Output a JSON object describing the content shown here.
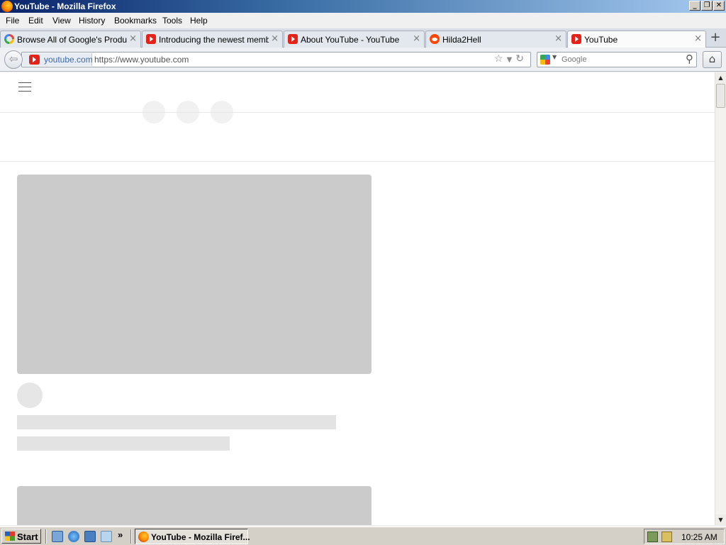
{
  "window": {
    "title": "YouTube - Mozilla Firefox",
    "controls": [
      "minimize",
      "maximize",
      "close"
    ]
  },
  "menu": {
    "items": [
      "File",
      "Edit",
      "View",
      "History",
      "Bookmarks",
      "Tools",
      "Help"
    ]
  },
  "tabs": [
    {
      "label": "Browse All of Google's Product...",
      "favicon": "google-icon",
      "active": false
    },
    {
      "label": "Introducing the newest memb...",
      "favicon": "youtube-icon",
      "active": false
    },
    {
      "label": "About YouTube - YouTube",
      "favicon": "youtube-icon",
      "active": false
    },
    {
      "label": "Hilda2Hell",
      "favicon": "reddit-icon",
      "active": false
    },
    {
      "label": "YouTube",
      "favicon": "youtube-icon",
      "active": true
    }
  ],
  "navbar": {
    "identity_label": "youtube.com",
    "url": "https://www.youtube.com",
    "search_placeholder": "Google"
  },
  "taskbar": {
    "start_label": "Start",
    "task_label": "YouTube - Mozilla Firef...",
    "clock": "10:25 AM",
    "overflow_glyph": "»"
  },
  "colors": {
    "youtube_red": "#e62117",
    "skeleton_thumb": "#cbcbcb",
    "skeleton_line": "#e3e3e3"
  }
}
